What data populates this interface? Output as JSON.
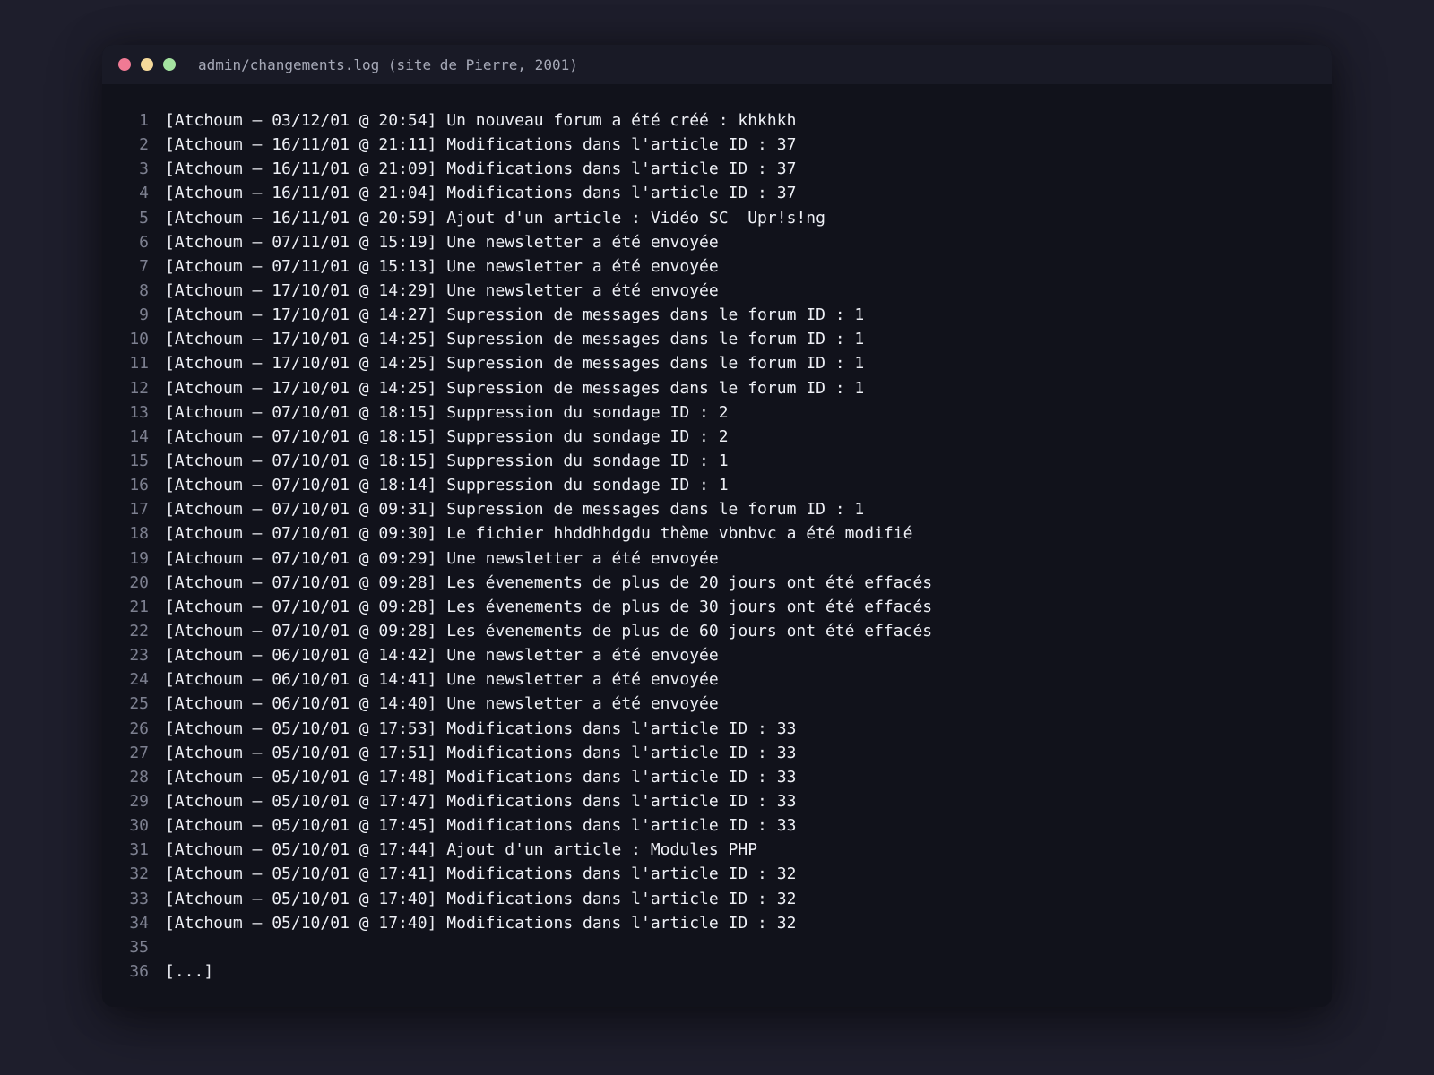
{
  "window": {
    "title": "admin/changements.log (site de Pierre, 2001)",
    "traffic_lights": [
      {
        "name": "close",
        "color": "#f07a94"
      },
      {
        "name": "minimize",
        "color": "#f5d99a"
      },
      {
        "name": "maximize",
        "color": "#a4e3a0"
      }
    ]
  },
  "log": {
    "lines": [
      {
        "n": "1",
        "text": "[Atchoum – 03/12/01 @ 20:54] Un nouveau forum a été créé : khkhkh"
      },
      {
        "n": "2",
        "text": "[Atchoum – 16/11/01 @ 21:11] Modifications dans l'article ID : 37"
      },
      {
        "n": "3",
        "text": "[Atchoum – 16/11/01 @ 21:09] Modifications dans l'article ID : 37"
      },
      {
        "n": "4",
        "text": "[Atchoum – 16/11/01 @ 21:04] Modifications dans l'article ID : 37"
      },
      {
        "n": "5",
        "text": "[Atchoum – 16/11/01 @ 20:59] Ajout d'un article : Vidéo SC  Upr!s!ng"
      },
      {
        "n": "6",
        "text": "[Atchoum – 07/11/01 @ 15:19] Une newsletter a été envoyée"
      },
      {
        "n": "7",
        "text": "[Atchoum – 07/11/01 @ 15:13] Une newsletter a été envoyée"
      },
      {
        "n": "8",
        "text": "[Atchoum – 17/10/01 @ 14:29] Une newsletter a été envoyée"
      },
      {
        "n": "9",
        "text": "[Atchoum – 17/10/01 @ 14:27] Supression de messages dans le forum ID : 1"
      },
      {
        "n": "10",
        "text": "[Atchoum – 17/10/01 @ 14:25] Supression de messages dans le forum ID : 1"
      },
      {
        "n": "11",
        "text": "[Atchoum – 17/10/01 @ 14:25] Supression de messages dans le forum ID : 1"
      },
      {
        "n": "12",
        "text": "[Atchoum – 17/10/01 @ 14:25] Supression de messages dans le forum ID : 1"
      },
      {
        "n": "13",
        "text": "[Atchoum – 07/10/01 @ 18:15] Suppression du sondage ID : 2"
      },
      {
        "n": "14",
        "text": "[Atchoum – 07/10/01 @ 18:15] Suppression du sondage ID : 2"
      },
      {
        "n": "15",
        "text": "[Atchoum – 07/10/01 @ 18:15] Suppression du sondage ID : 1"
      },
      {
        "n": "16",
        "text": "[Atchoum – 07/10/01 @ 18:14] Suppression du sondage ID : 1"
      },
      {
        "n": "17",
        "text": "[Atchoum – 07/10/01 @ 09:31] Supression de messages dans le forum ID : 1"
      },
      {
        "n": "18",
        "text": "[Atchoum – 07/10/01 @ 09:30] Le fichier hhddhhdgdu thème vbnbvc a été modifié"
      },
      {
        "n": "19",
        "text": "[Atchoum – 07/10/01 @ 09:29] Une newsletter a été envoyée"
      },
      {
        "n": "20",
        "text": "[Atchoum – 07/10/01 @ 09:28] Les évenements de plus de 20 jours ont été effacés"
      },
      {
        "n": "21",
        "text": "[Atchoum – 07/10/01 @ 09:28] Les évenements de plus de 30 jours ont été effacés"
      },
      {
        "n": "22",
        "text": "[Atchoum – 07/10/01 @ 09:28] Les évenements de plus de 60 jours ont été effacés"
      },
      {
        "n": "23",
        "text": "[Atchoum – 06/10/01 @ 14:42] Une newsletter a été envoyée"
      },
      {
        "n": "24",
        "text": "[Atchoum – 06/10/01 @ 14:41] Une newsletter a été envoyée"
      },
      {
        "n": "25",
        "text": "[Atchoum – 06/10/01 @ 14:40] Une newsletter a été envoyée"
      },
      {
        "n": "26",
        "text": "[Atchoum – 05/10/01 @ 17:53] Modifications dans l'article ID : 33"
      },
      {
        "n": "27",
        "text": "[Atchoum – 05/10/01 @ 17:51] Modifications dans l'article ID : 33"
      },
      {
        "n": "28",
        "text": "[Atchoum – 05/10/01 @ 17:48] Modifications dans l'article ID : 33"
      },
      {
        "n": "29",
        "text": "[Atchoum – 05/10/01 @ 17:47] Modifications dans l'article ID : 33"
      },
      {
        "n": "30",
        "text": "[Atchoum – 05/10/01 @ 17:45] Modifications dans l'article ID : 33"
      },
      {
        "n": "31",
        "text": "[Atchoum – 05/10/01 @ 17:44] Ajout d'un article : Modules PHP"
      },
      {
        "n": "32",
        "text": "[Atchoum – 05/10/01 @ 17:41] Modifications dans l'article ID : 32"
      },
      {
        "n": "33",
        "text": "[Atchoum – 05/10/01 @ 17:40] Modifications dans l'article ID : 32"
      },
      {
        "n": "34",
        "text": "[Atchoum – 05/10/01 @ 17:40] Modifications dans l'article ID : 32"
      },
      {
        "n": "35",
        "text": ""
      },
      {
        "n": "36",
        "text": "[...]"
      }
    ]
  }
}
